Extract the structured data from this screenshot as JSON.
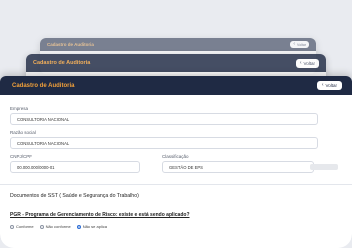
{
  "windows": [
    {
      "title": "Cadastro de Auditoria",
      "back_label": "Voltar"
    },
    {
      "title": "Cadastro de Auditoria",
      "back_label": "Voltar"
    }
  ],
  "main": {
    "title": "Cadastro de Auditoria",
    "back_label": "Voltar",
    "fields": {
      "empresa": {
        "label": "Empresa",
        "value": "CONSULTORIA NACIONAL"
      },
      "razao": {
        "label": "Razão social",
        "value": "CONSULTORIA NACIONAL"
      },
      "cnpj": {
        "label": "CNPJ/CPF",
        "value": "00.000.000/0000-01"
      },
      "classificacao": {
        "label": "Classificação",
        "value": "GESTÃO DE EPS"
      }
    },
    "section_title": "Documentos de SST ( Saúde e Segurança do Trabalho)",
    "question": "PGR - Programa de Gerenciamento de Risco: existe e está sendo aplicado?",
    "options": [
      "Conforme",
      "Não conforme",
      "Não se aplica"
    ],
    "selected_option": "Não se aplica"
  },
  "colors": {
    "header_bg": "#1f2a44",
    "title_accent": "#f2a13a",
    "radio_selected": "#2b6cd4"
  },
  "icons": {
    "back": "arrow-left-icon"
  }
}
